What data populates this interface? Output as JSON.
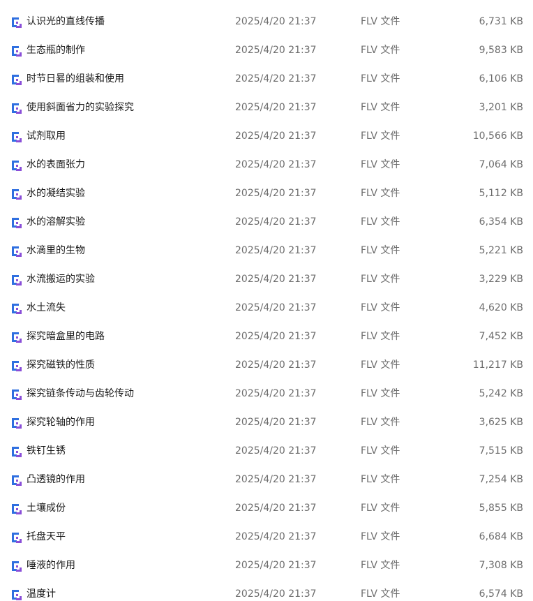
{
  "colors": {
    "icon_blue": "#2f6fe0",
    "icon_purple": "#8a4fd8",
    "name_text": "#1a1a1a",
    "meta_text": "#6d6d6d"
  },
  "file_icon": "video-file-icon",
  "files": [
    {
      "name": "认识光的直线传播",
      "modified": "2025/4/20 21:37",
      "type": "FLV 文件",
      "size": "6,731 KB"
    },
    {
      "name": "生态瓶的制作",
      "modified": "2025/4/20 21:37",
      "type": "FLV 文件",
      "size": "9,583 KB"
    },
    {
      "name": "时节日晷的组装和使用",
      "modified": "2025/4/20 21:37",
      "type": "FLV 文件",
      "size": "6,106 KB"
    },
    {
      "name": "使用斜面省力的实验探究",
      "modified": "2025/4/20 21:37",
      "type": "FLV 文件",
      "size": "3,201 KB"
    },
    {
      "name": "试剂取用",
      "modified": "2025/4/20 21:37",
      "type": "FLV 文件",
      "size": "10,566 KB"
    },
    {
      "name": "水的表面张力",
      "modified": "2025/4/20 21:37",
      "type": "FLV 文件",
      "size": "7,064 KB"
    },
    {
      "name": "水的凝结实验",
      "modified": "2025/4/20 21:37",
      "type": "FLV 文件",
      "size": "5,112 KB"
    },
    {
      "name": "水的溶解实验",
      "modified": "2025/4/20 21:37",
      "type": "FLV 文件",
      "size": "6,354 KB"
    },
    {
      "name": "水滴里的生物",
      "modified": "2025/4/20 21:37",
      "type": "FLV 文件",
      "size": "5,221 KB"
    },
    {
      "name": "水流搬运的实验",
      "modified": "2025/4/20 21:37",
      "type": "FLV 文件",
      "size": "3,229 KB"
    },
    {
      "name": "水土流失",
      "modified": "2025/4/20 21:37",
      "type": "FLV 文件",
      "size": "4,620 KB"
    },
    {
      "name": "探究暗盒里的电路",
      "modified": "2025/4/20 21:37",
      "type": "FLV 文件",
      "size": "7,452 KB"
    },
    {
      "name": "探究磁铁的性质",
      "modified": "2025/4/20 21:37",
      "type": "FLV 文件",
      "size": "11,217 KB"
    },
    {
      "name": "探究链条传动与齿轮传动",
      "modified": "2025/4/20 21:37",
      "type": "FLV 文件",
      "size": "5,242 KB"
    },
    {
      "name": "探究轮轴的作用",
      "modified": "2025/4/20 21:37",
      "type": "FLV 文件",
      "size": "3,625 KB"
    },
    {
      "name": "铁钉生锈",
      "modified": "2025/4/20 21:37",
      "type": "FLV 文件",
      "size": "7,515 KB"
    },
    {
      "name": "凸透镜的作用",
      "modified": "2025/4/20 21:37",
      "type": "FLV 文件",
      "size": "7,254 KB"
    },
    {
      "name": "土壤成份",
      "modified": "2025/4/20 21:37",
      "type": "FLV 文件",
      "size": "5,855 KB"
    },
    {
      "name": "托盘天平",
      "modified": "2025/4/20 21:37",
      "type": "FLV 文件",
      "size": "6,684 KB"
    },
    {
      "name": "唾液的作用",
      "modified": "2025/4/20 21:37",
      "type": "FLV 文件",
      "size": "7,308 KB"
    },
    {
      "name": "温度计",
      "modified": "2025/4/20 21:37",
      "type": "FLV 文件",
      "size": "6,574 KB"
    }
  ]
}
